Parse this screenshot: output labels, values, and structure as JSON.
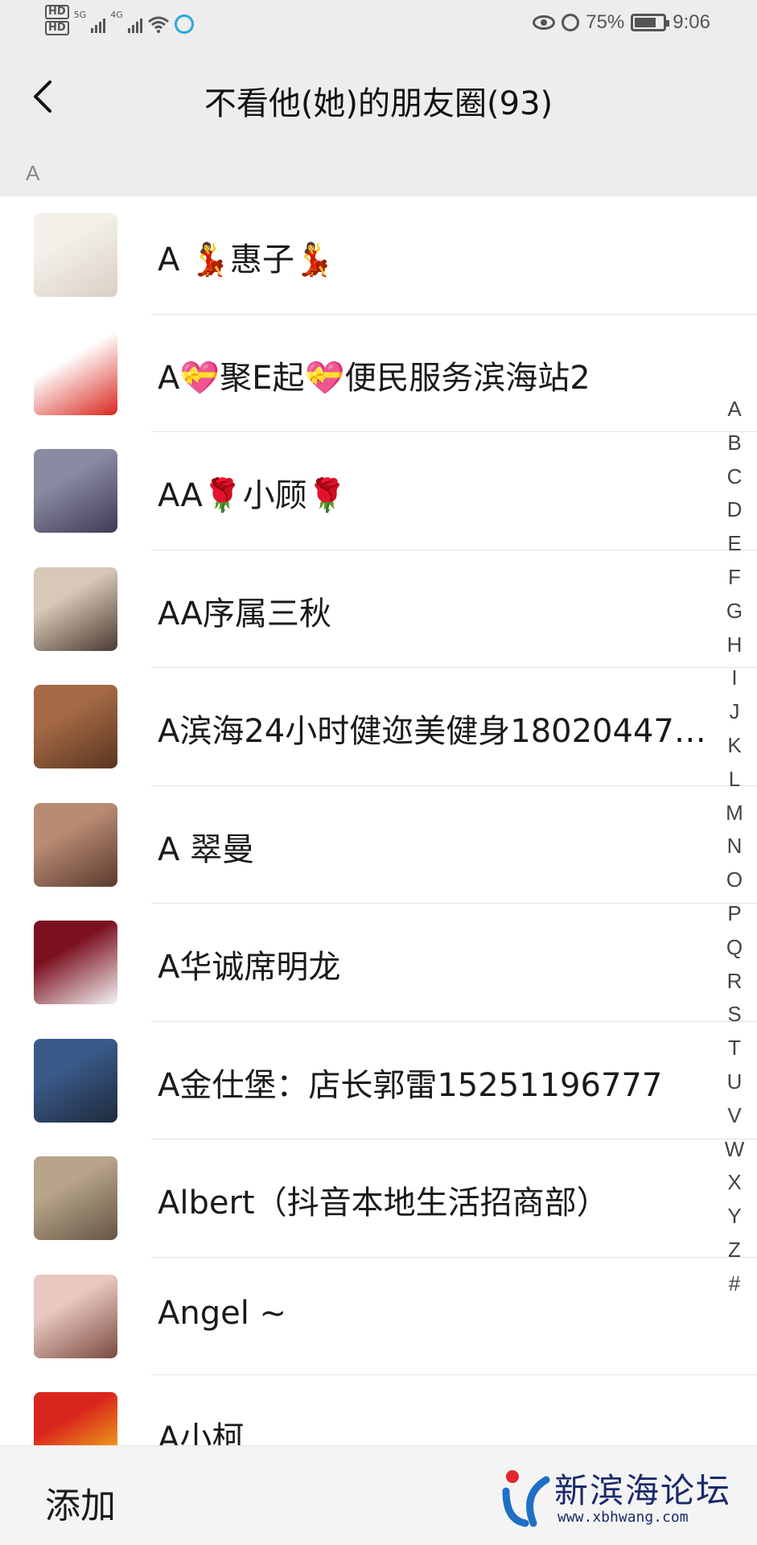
{
  "status_bar": {
    "hd1": "HD",
    "hd2": "HD",
    "network1": "5G",
    "network2": "4G",
    "battery_percent": "75%",
    "battery_level": 0.75,
    "time": "9:06",
    "icons": [
      "eye-icon",
      "alarm-icon",
      "battery-icon",
      "wifi-icon",
      "signal-icon"
    ]
  },
  "nav": {
    "title": "不看他(她)的朋友圈(93)"
  },
  "section": {
    "letter": "A"
  },
  "contacts": [
    {
      "name": "A 💃惠子💃",
      "avatar_colors": [
        "#f3efe9",
        "#d8d0c4"
      ]
    },
    {
      "name": "A💝聚E起💝便民服务滨海站2",
      "avatar_colors": [
        "#ffffff",
        "#d9261c"
      ]
    },
    {
      "name": "AA🌹小顾🌹",
      "avatar_colors": [
        "#8b8aa3",
        "#3e3b55"
      ]
    },
    {
      "name": "AA序属三秋",
      "avatar_colors": [
        "#d8c8b8",
        "#4a3a30"
      ]
    },
    {
      "name": "A滨海24小时健迩美健身18020447…",
      "avatar_colors": [
        "#a56a45",
        "#5a3520"
      ]
    },
    {
      "name": "A 翠曼",
      "avatar_colors": [
        "#b98b73",
        "#5a3a2e"
      ]
    },
    {
      "name": "A华诚席明龙",
      "avatar_colors": [
        "#7b1020",
        "#f3f3f3"
      ]
    },
    {
      "name": "A金仕堡：店长郭雷15251196777",
      "avatar_colors": [
        "#3a5a8a",
        "#1e2a3a"
      ]
    },
    {
      "name": "Albert（抖音本地生活招商部）",
      "avatar_colors": [
        "#b7a48a",
        "#665544"
      ]
    },
    {
      "name": "Angel ~",
      "avatar_colors": [
        "#e8c8c0",
        "#7a4a40"
      ]
    },
    {
      "name": "A小柯",
      "avatar_colors": [
        "#d9261c",
        "#f7d21a"
      ]
    }
  ],
  "index_letters": [
    "A",
    "B",
    "C",
    "D",
    "E",
    "F",
    "G",
    "H",
    "I",
    "J",
    "K",
    "L",
    "M",
    "N",
    "O",
    "P",
    "Q",
    "R",
    "S",
    "T",
    "U",
    "V",
    "W",
    "X",
    "Y",
    "Z",
    "#"
  ],
  "bottom": {
    "add_label": "添加"
  },
  "watermark": {
    "text": "新滨海论坛",
    "url": "www.xbhwang.com"
  }
}
